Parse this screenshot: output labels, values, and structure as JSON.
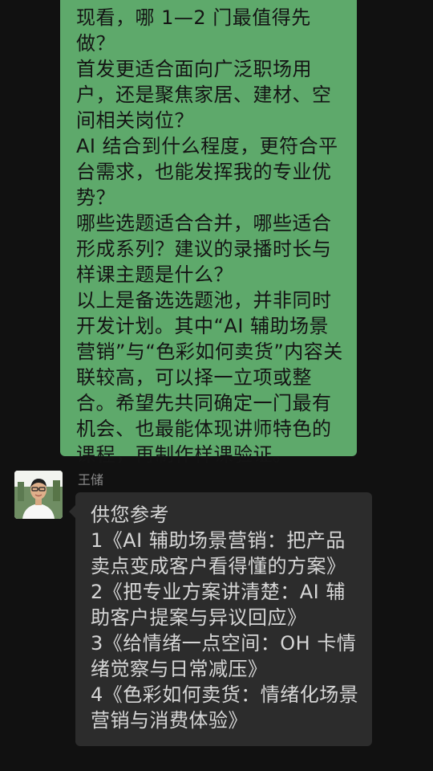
{
  "chat": {
    "sent_message": {
      "text": "现看，哪 1—2 门最值得先做？\n首发更适合面向广泛职场用户，还是聚焦家居、建材、空间相关岗位？\nAI 结合到什么程度，更符合平台需求，也能发挥我的专业优势？\n哪些选题适合合并，哪些适合形成系列？建议的录播时长与样课主题是什么？\n以上是备选选题池，并非同时开发计划。其中“AI 辅助场景营销”与“色彩如何卖货”内容关联较高，可以择一立项或整合。希望先共同确定一门最有机会、也最能体现讲师特色的课程，再制作样课验证。"
    },
    "received_message": {
      "sender_name": "王储",
      "text": "供您参考\n1《AI 辅助场景营销：把产品卖点变成客户看得懂的方案》\n2《把专业方案讲清楚：AI 辅助客户提案与异议回应》\n3《给情绪一点空间：OH 卡情绪觉察与日常减压》\n4《色彩如何卖货：情绪化场景营销与消费体验》"
    }
  },
  "colors": {
    "background": "#111111",
    "sent_bubble": "#5ea96b",
    "received_bubble": "#2c2c2c",
    "received_text": "#d6d6d6",
    "name_text": "#8a8a8a"
  }
}
